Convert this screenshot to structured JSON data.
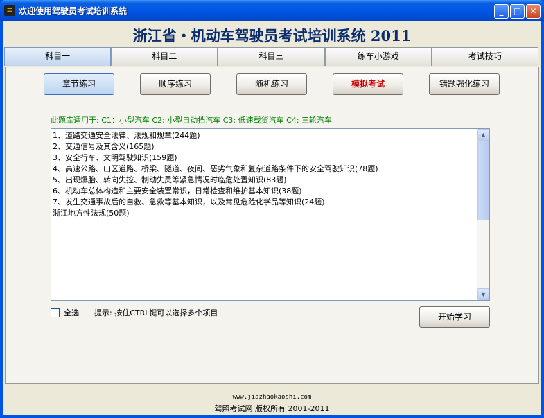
{
  "window": {
    "title": "欢迎使用驾驶员考试培训系统",
    "app_icon": "traffic-light-icon",
    "minimize_glyph": "_",
    "maximize_glyph": "□",
    "close_glyph": "✕"
  },
  "header": {
    "title": "浙江省・机动车驾驶员考试培训系统 2011"
  },
  "tabs": [
    {
      "label": "科目一",
      "active": true
    },
    {
      "label": "科目二",
      "active": false
    },
    {
      "label": "科目三",
      "active": false
    },
    {
      "label": "练车小游戏",
      "active": false
    },
    {
      "label": "考试技巧",
      "active": false
    }
  ],
  "modes": [
    {
      "label": "章节练习",
      "active": true
    },
    {
      "label": "顺序练习",
      "active": false
    },
    {
      "label": "随机练习",
      "active": false
    },
    {
      "label": "模拟考试",
      "active": false,
      "color": "#cc0000"
    },
    {
      "label": "错题强化练习",
      "active": false
    }
  ],
  "apply_text": "此题库适用于: C1：小型汽车 C2: 小型自动挡汽车 C3: 低速载货汽车 C4: 三轮汽车",
  "chapters": [
    "1、道路交通安全法律、法规和规章(244题)",
    "2、交通信号及其含义(165题)",
    "3、安全行车、文明驾驶知识(159题)",
    "4、高速公路、山区道路、桥梁、隧道、夜间、恶劣气象和复杂道路条件下的安全驾驶知识(78题)",
    "5、出现爆胎、转向失控、制动失灵等紧急情况时临危处置知识(83题)",
    "6、机动车总体构造和主要安全装置常识，日常检查和维护基本知识(38题)",
    "7、发生交通事故后的自救、急救等基本知识，以及常见危险化学品等知识(24题)",
    "浙江地方性法规(50题)"
  ],
  "select_all": {
    "label": "全选",
    "checked": false
  },
  "hint": "提示: 按住CTRL键可以选择多个项目",
  "start_button": "开始学习",
  "footer": {
    "url": "www.jiazhaokaoshi.com",
    "copyright": "驾照考试网 版权所有 2001-2011"
  }
}
